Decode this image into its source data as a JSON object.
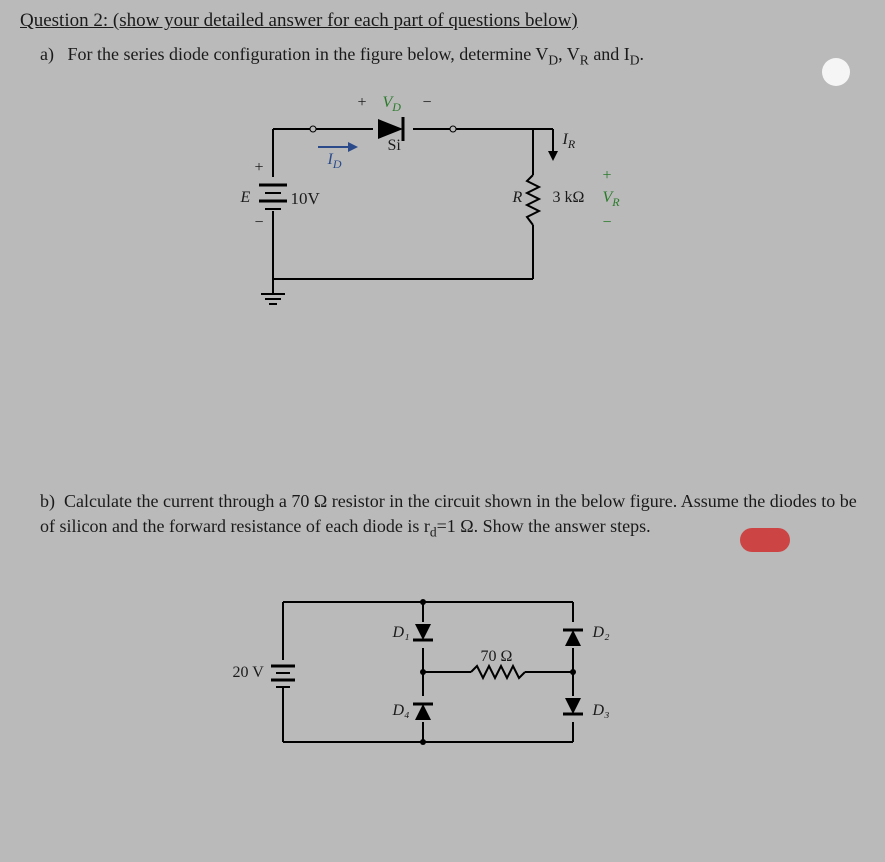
{
  "question_title": "Question 2:   (show your detailed answer for each part of questions below)",
  "part_a": {
    "prefix": "a)",
    "text": "For the series diode configuration in the figure below, determine V",
    "sub1": "D",
    "text2": ", V",
    "sub2": "R",
    "text3": " and I",
    "sub3": "D",
    "text4": "."
  },
  "circuit_a": {
    "vd_plus": "+",
    "vd": "V",
    "vd_sub": "D",
    "vd_minus": "−",
    "si": "Si",
    "id": "I",
    "id_sub": "D",
    "e_label": "E",
    "plus_e": "+",
    "minus_e": "−",
    "e_val": "10V",
    "ir": "I",
    "ir_sub": "R",
    "r_label": "R",
    "r_val": "3 kΩ",
    "vr": "V",
    "vr_sub": "R",
    "plus_r": "+",
    "minus_r": "−"
  },
  "part_b": {
    "prefix": "b)",
    "text1": "Calculate the current through a 70 Ω resistor in the circuit shown in the below figure. Assume the diodes to be of silicon and the forward resistance of each diode is r",
    "sub_d": "d",
    "text2": "=1 Ω. Show the answer steps."
  },
  "circuit_b": {
    "v_src": "20 V",
    "d1": "D₁",
    "d2": "D₂",
    "d3": "D₃",
    "d4": "D₄",
    "r_val": "70 Ω"
  }
}
